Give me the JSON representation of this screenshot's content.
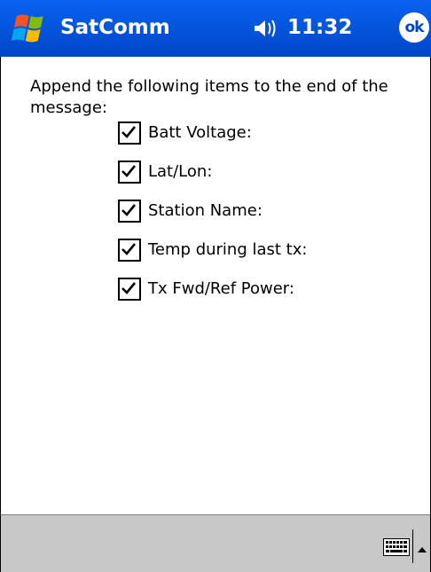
{
  "titlebar": {
    "app_title": "SatComm",
    "clock": "11:32",
    "ok_label": "ok",
    "start_icon": "windows-start-icon",
    "volume_icon": "speaker-icon"
  },
  "content": {
    "instructions": "Append the following items to the end of the message:",
    "options": [
      {
        "label": "Batt Voltage:",
        "checked": true
      },
      {
        "label": "Lat/Lon:",
        "checked": true
      },
      {
        "label": "Station Name:",
        "checked": true
      },
      {
        "label": "Temp during last tx:",
        "checked": true
      },
      {
        "label": "Tx Fwd/Ref Power:",
        "checked": true
      }
    ]
  },
  "menubar": {
    "keyboard_icon": "keyboard-icon",
    "sip_arrow_icon": "chevron-up-icon"
  },
  "colors": {
    "titlebar": "#0054e3",
    "menubar": "#c8c8c8",
    "background": "#ffffff"
  }
}
